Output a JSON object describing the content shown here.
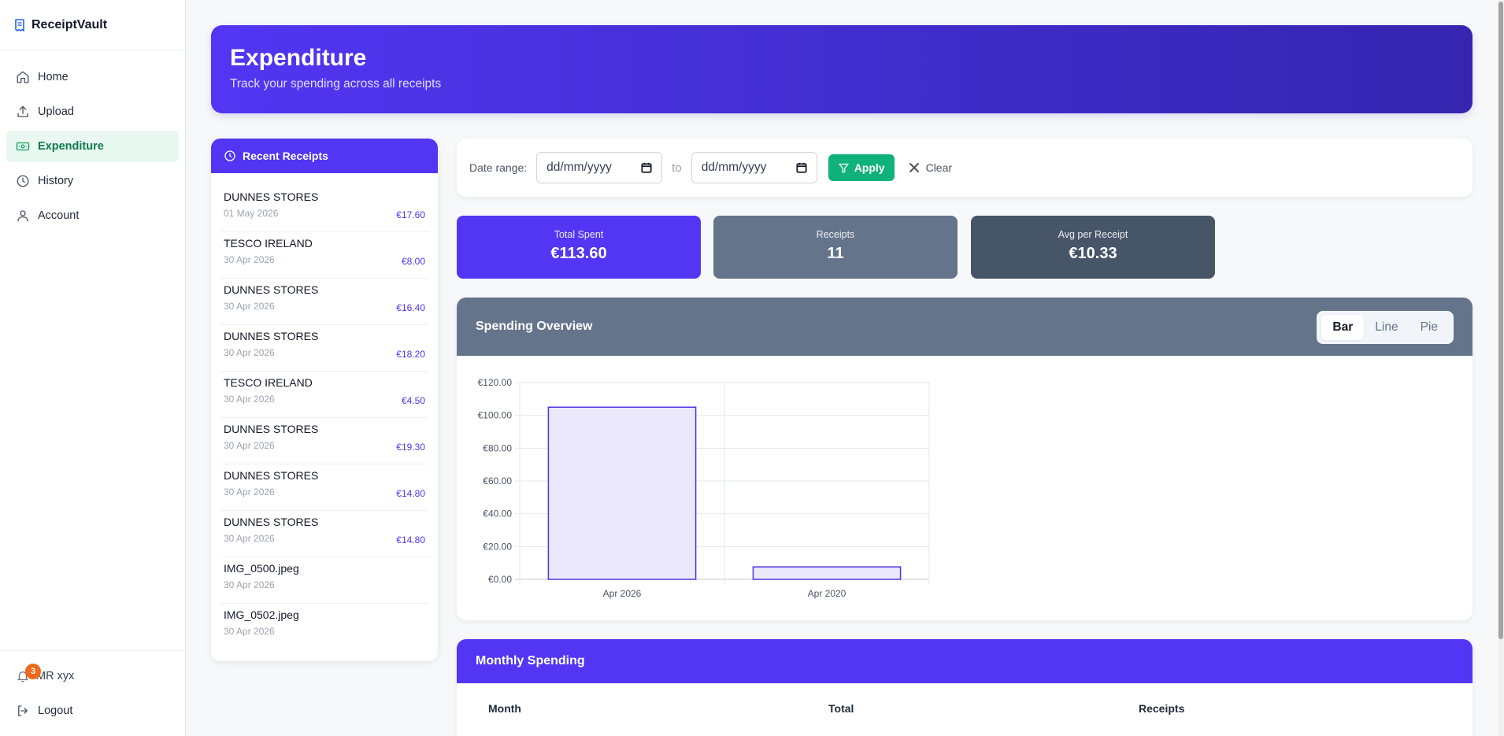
{
  "brand": {
    "name": "ReceiptVault"
  },
  "nav": [
    {
      "label": "Home",
      "icon": "home-icon"
    },
    {
      "label": "Upload",
      "icon": "upload-icon"
    },
    {
      "label": "Expenditure",
      "icon": "banknote-icon",
      "active": true
    },
    {
      "label": "History",
      "icon": "clock-icon"
    },
    {
      "label": "Account",
      "icon": "user-icon"
    }
  ],
  "user": {
    "name": "MR xyx",
    "notifications": "3",
    "logout_label": "Logout"
  },
  "header": {
    "title": "Expenditure",
    "subtitle": "Track your spending across all receipts"
  },
  "recent": {
    "title": "Recent Receipts",
    "items": [
      {
        "name": "DUNNES STORES",
        "date": "01 May 2026",
        "amount": "€17.60"
      },
      {
        "name": "TESCO IRELAND",
        "date": "30 Apr 2026",
        "amount": "€8.00"
      },
      {
        "name": "DUNNES STORES",
        "date": "30 Apr 2026",
        "amount": "€16.40"
      },
      {
        "name": "DUNNES STORES",
        "date": "30 Apr 2026",
        "amount": "€18.20"
      },
      {
        "name": "TESCO IRELAND",
        "date": "30 Apr 2026",
        "amount": "€4.50"
      },
      {
        "name": "DUNNES STORES",
        "date": "30 Apr 2026",
        "amount": "€19.30"
      },
      {
        "name": "DUNNES STORES",
        "date": "30 Apr 2026",
        "amount": "€14.80"
      },
      {
        "name": "DUNNES STORES",
        "date": "30 Apr 2026",
        "amount": "€14.80"
      },
      {
        "name": "IMG_0500.jpeg",
        "date": "30 Apr 2026",
        "amount": ""
      },
      {
        "name": "IMG_0502.jpeg",
        "date": "30 Apr 2026",
        "amount": ""
      }
    ]
  },
  "filter": {
    "label": "Date range:",
    "from_placeholder": "dd/mm/yyyy",
    "to_label": "to",
    "to_placeholder": "dd/mm/yyyy",
    "apply_label": "Apply",
    "clear_label": "Clear"
  },
  "stats": {
    "total": {
      "label": "Total Spent",
      "value": "€113.60"
    },
    "receipts": {
      "label": "Receipts",
      "value": "11"
    },
    "avg": {
      "label": "Avg per Receipt",
      "value": "€10.33"
    }
  },
  "chart": {
    "title": "Spending Overview",
    "toggle": [
      "Bar",
      "Line",
      "Pie"
    ],
    "active_toggle": "Bar"
  },
  "chart_data": {
    "type": "bar",
    "categories": [
      "Apr 2026",
      "Apr 2020"
    ],
    "values": [
      105,
      7.6
    ],
    "ylim": [
      0,
      120
    ],
    "yticks": [
      "€0.00",
      "€20.00",
      "€40.00",
      "€60.00",
      "€80.00",
      "€100.00",
      "€120.00"
    ],
    "ytick_values": [
      0,
      20,
      40,
      60,
      80,
      100,
      120
    ],
    "grid": true,
    "bar_fill": "#ebe8fb",
    "bar_stroke": "#4f35e6"
  },
  "monthly": {
    "title": "Monthly Spending",
    "columns": [
      "Month",
      "Total",
      "Receipts"
    ]
  },
  "colors": {
    "accent": "#5236f3",
    "success": "#10b27a",
    "slate": "#64748b"
  }
}
